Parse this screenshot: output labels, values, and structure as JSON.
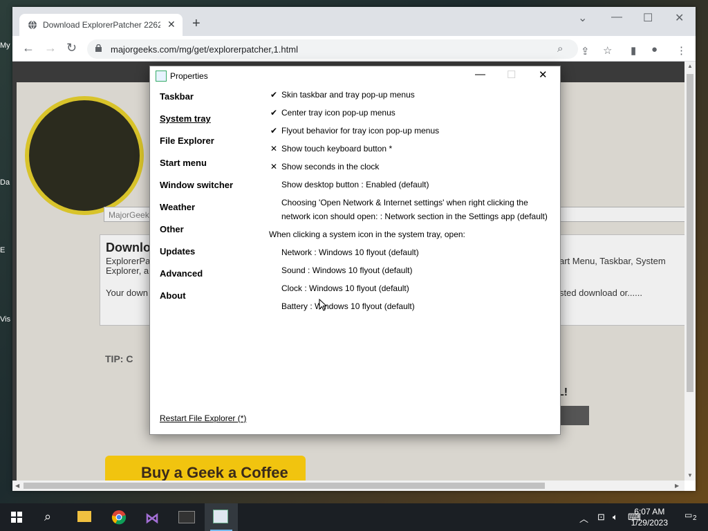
{
  "desktop": {
    "icon_labels": [
      "My",
      "Da",
      "E",
      "Vis"
    ]
  },
  "browser": {
    "tab_title": "Download ExplorerPatcher 2262",
    "new_tab_symbol": "+",
    "url": "majorgeeks.com/mg/get/explorerpatcher,1.html"
  },
  "page": {
    "search_placeholder": "MajorGeeks",
    "heading": "Downlo",
    "sub_left": "ExplorerPa",
    "sub_left2": "Explorer, a",
    "body_left": "Your down",
    "sub_right": "art Menu, Taskbar, System",
    "body_right": "sted download or......",
    "tip": "TIP: C",
    "exclaim": "L!",
    "coffee": "Buy a Geek a Coffee"
  },
  "dialog": {
    "title": "Properties",
    "nav": [
      {
        "label": "Taskbar",
        "active": false
      },
      {
        "label": "System tray",
        "active": true
      },
      {
        "label": "File Explorer",
        "active": false
      },
      {
        "label": "Start menu",
        "active": false
      },
      {
        "label": "Window switcher",
        "active": false
      },
      {
        "label": "Weather",
        "active": false
      },
      {
        "label": "Other",
        "active": false
      },
      {
        "label": "Updates",
        "active": false
      },
      {
        "label": "Advanced",
        "active": false
      },
      {
        "label": "About",
        "active": false
      }
    ],
    "options": [
      {
        "mark": "✔",
        "text": "Skin taskbar and tray pop-up menus"
      },
      {
        "mark": "✔",
        "text": "Center tray icon pop-up menus"
      },
      {
        "mark": "✔",
        "text": "Flyout behavior for tray icon pop-up menus"
      },
      {
        "mark": "✕",
        "text": "Show touch keyboard button *"
      },
      {
        "mark": "✕",
        "text": "Show seconds in the clock"
      },
      {
        "mark": "",
        "text": "Show desktop button : Enabled (default)"
      }
    ],
    "network_setting_line1": "Choosing 'Open Network & Internet settings' when right clicking the",
    "network_setting_line2": "network icon should open: : Network section in the Settings app (default)",
    "system_icon_header": "When clicking a system icon in the system tray, open:",
    "flyouts": [
      "Network : Windows 10 flyout (default)",
      "Sound : Windows 10 flyout (default)",
      "Clock : Windows 10 flyout (default)",
      "Battery : Windows 10 flyout (default)"
    ],
    "restart_link": "Restart File Explorer (*)"
  },
  "taskbar": {
    "time": "6:07 AM",
    "date": "1/29/2023",
    "notification_count": "2"
  }
}
